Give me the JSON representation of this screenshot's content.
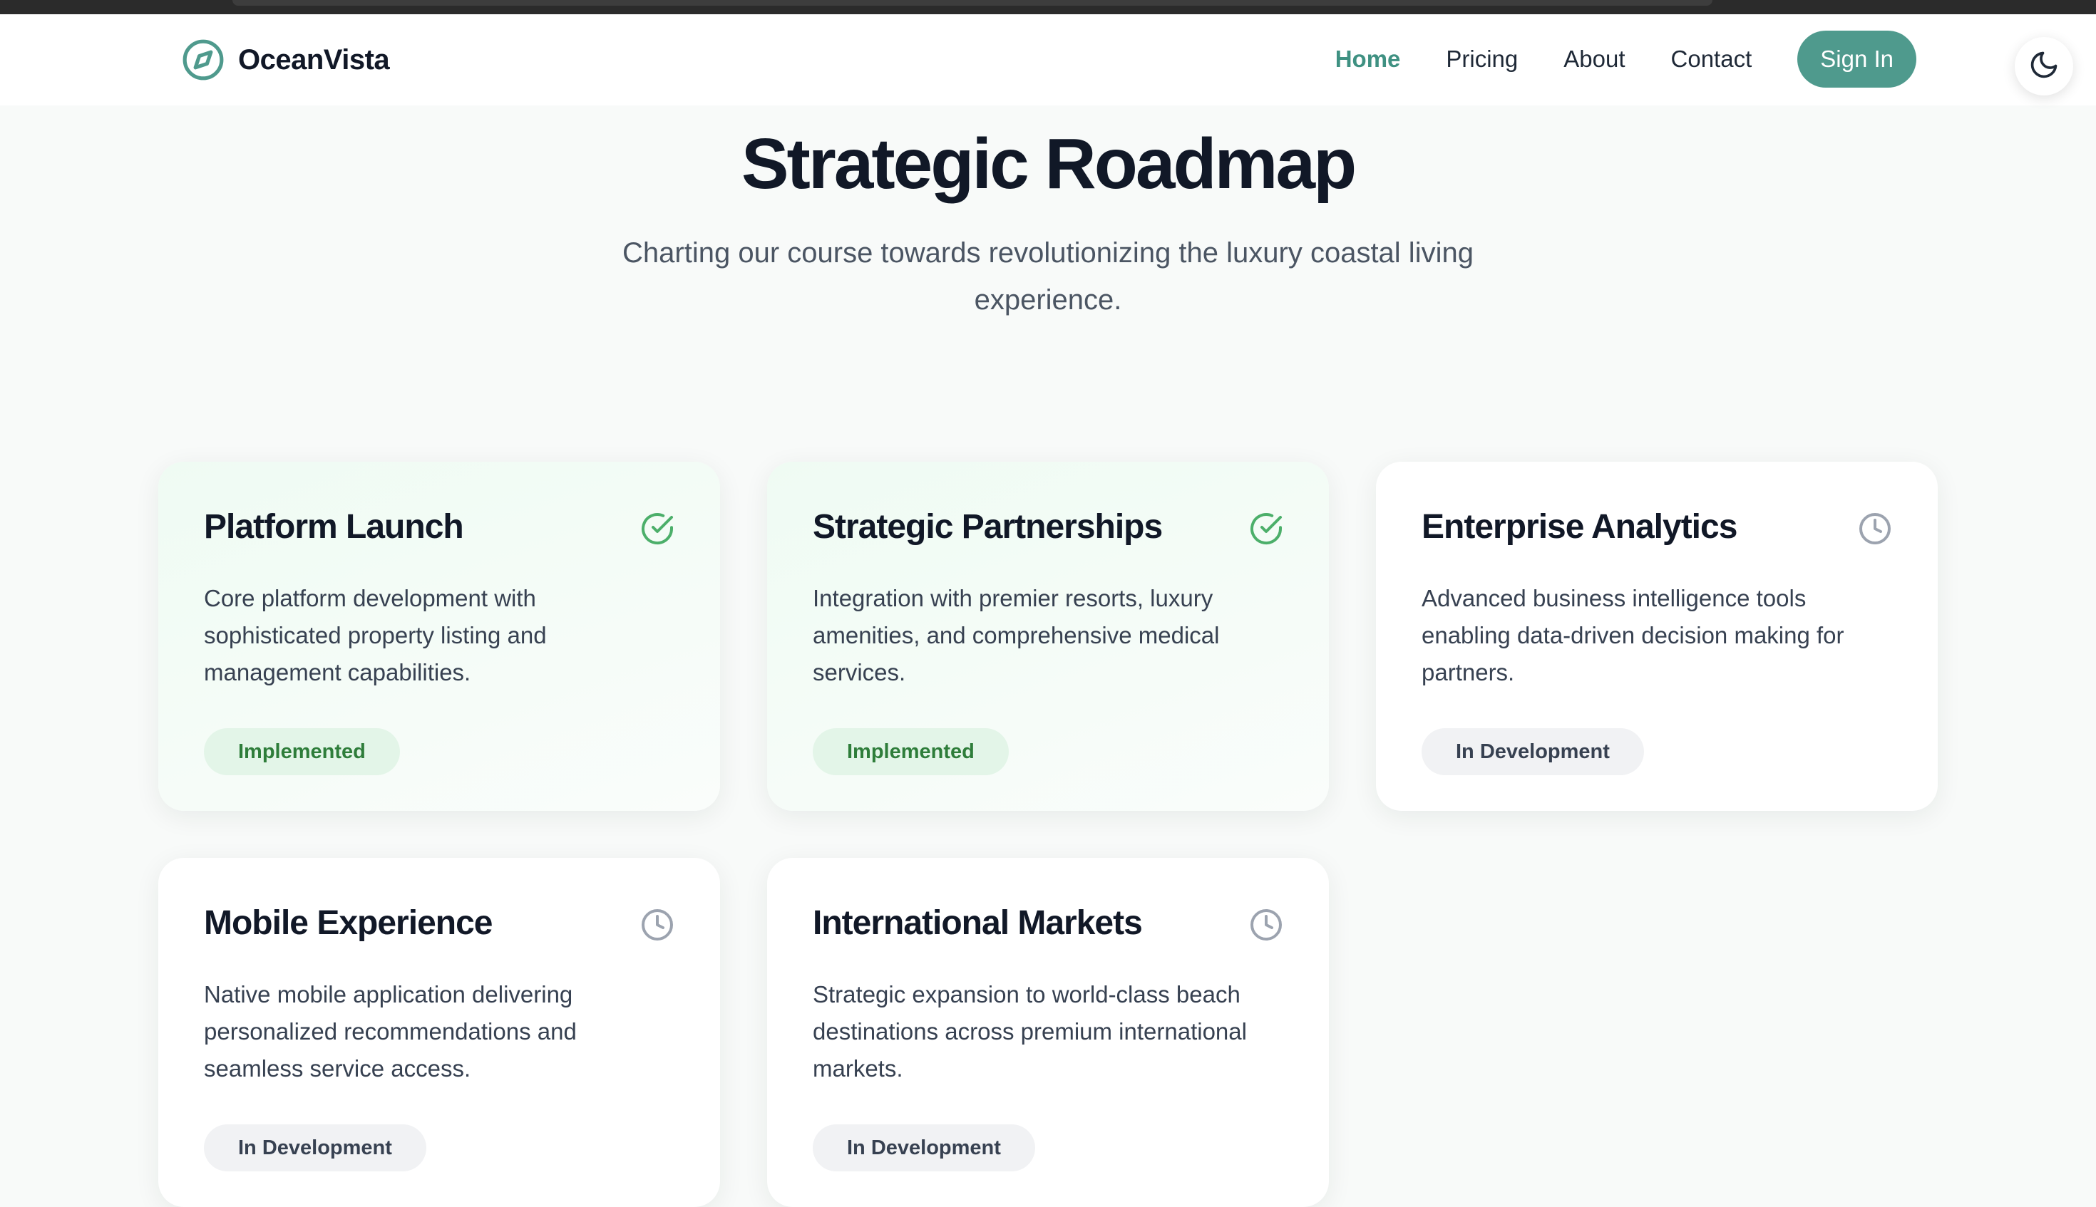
{
  "brand": {
    "name": "OceanVista",
    "icon": "compass-icon",
    "accent": "#4f9a8d"
  },
  "nav": {
    "items": [
      {
        "label": "Home",
        "active": true
      },
      {
        "label": "Pricing",
        "active": false
      },
      {
        "label": "About",
        "active": false
      },
      {
        "label": "Contact",
        "active": false
      }
    ],
    "signin_label": "Sign In",
    "theme_icon": "moon-icon"
  },
  "hero": {
    "title": "Strategic Roadmap",
    "subtitle": "Charting our course towards revolutionizing the luxury coastal living experience."
  },
  "cards": [
    {
      "title": "Platform Launch",
      "description": "Core platform development with sophisticated property listing and management capabilities.",
      "status": "Implemented",
      "icon": "check-circle-icon"
    },
    {
      "title": "Strategic Partnerships",
      "description": "Integration with premier resorts, luxury amenities, and comprehensive medical services.",
      "status": "Implemented",
      "icon": "check-circle-icon"
    },
    {
      "title": "Enterprise Analytics",
      "description": "Advanced business intelligence tools enabling data-driven decision making for partners.",
      "status": "In Development",
      "icon": "clock-icon"
    },
    {
      "title": "Mobile Experience",
      "description": "Native mobile application delivering personalized recommendations and seamless service access.",
      "status": "In Development",
      "icon": "clock-icon"
    },
    {
      "title": "International Markets",
      "description": "Strategic expansion to world-class beach destinations across premium international markets.",
      "status": "In Development",
      "icon": "clock-icon"
    }
  ],
  "colors": {
    "implemented": "#4caf6a",
    "in_development": "#9ca3af"
  }
}
